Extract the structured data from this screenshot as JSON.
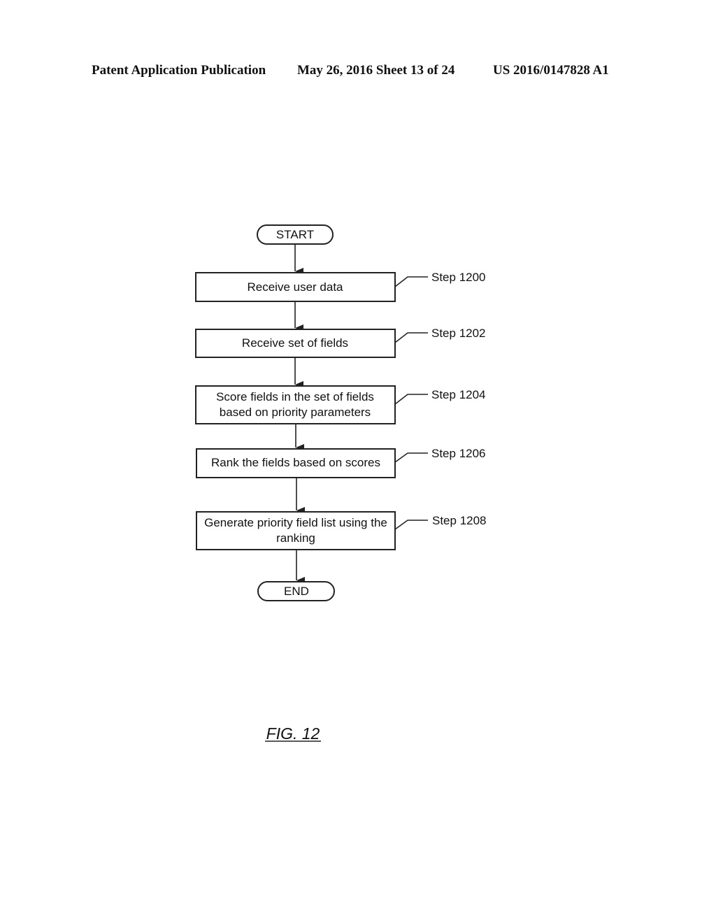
{
  "header": {
    "publication": "Patent Application Publication",
    "date_sheet": "May 26, 2016  Sheet 13 of 24",
    "number": "US 2016/0147828 A1"
  },
  "flowchart": {
    "start": "START",
    "end": "END",
    "steps": [
      {
        "lines": [
          "Receive user data"
        ],
        "label": "Step 1200"
      },
      {
        "lines": [
          "Receive set of fields"
        ],
        "label": "Step 1202"
      },
      {
        "lines": [
          "Score fields in the set of fields",
          "based on priority parameters"
        ],
        "label": "Step 1204"
      },
      {
        "lines": [
          "Rank the fields based on scores"
        ],
        "label": "Step 1206"
      },
      {
        "lines": [
          "Generate priority field list using the",
          "ranking"
        ],
        "label": "Step 1208"
      }
    ]
  },
  "figure_caption": "FIG. 12"
}
